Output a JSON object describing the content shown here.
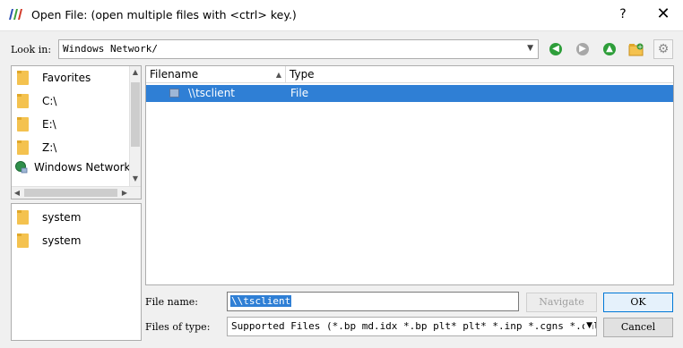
{
  "window": {
    "title": "Open File:  (open multiple files with <ctrl> key.)",
    "help_label": "?",
    "close_label": "✕"
  },
  "lookin": {
    "label": "Look in:",
    "value": "Windows Network/"
  },
  "toolbar": {
    "back_icon": "arrow-left-icon",
    "forward_icon": "arrow-right-icon",
    "up_icon": "arrow-up-icon",
    "new_folder_icon": "new-folder-icon",
    "settings_icon": "gear-icon",
    "colors": {
      "back": "#2e9e3a",
      "forward": "#a8a8a8",
      "up": "#2e9e3a"
    }
  },
  "sidebar": {
    "places": [
      {
        "label": "Favorites",
        "icon": "folder-icon"
      },
      {
        "label": "C:\\",
        "icon": "folder-icon"
      },
      {
        "label": "E:\\",
        "icon": "folder-icon"
      },
      {
        "label": "Z:\\",
        "icon": "folder-icon"
      },
      {
        "label": "Windows Network",
        "icon": "network-icon"
      }
    ],
    "recent": [
      {
        "label": "system",
        "icon": "folder-icon"
      },
      {
        "label": "system",
        "icon": "folder-icon"
      }
    ]
  },
  "filelist": {
    "columns": [
      "Filename",
      "Type"
    ],
    "rows": [
      {
        "name": "\\\\tsclient",
        "type": "File",
        "selected": true
      }
    ]
  },
  "footer": {
    "filename_label": "File name:",
    "filename_value": "\\\\tsclient",
    "navigate_label": "Navigate",
    "ok_label": "OK",
    "filetype_label": "Files of type:",
    "filetype_value": "Supported Files (*.bp md.idx *.bp plt* plt* *.inp *.cgns *.cml *.",
    "cancel_label": "Cancel"
  },
  "colors": {
    "selection": "#2f7fd5",
    "folder": "#f4c24f"
  }
}
